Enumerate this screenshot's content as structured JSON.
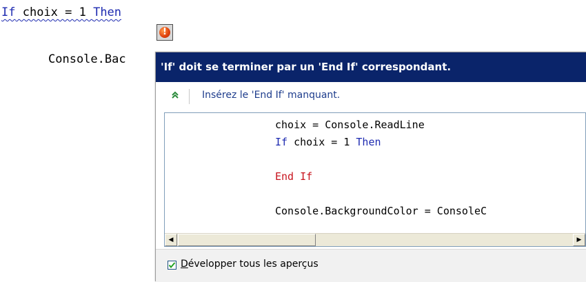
{
  "editor": {
    "line1": {
      "kw_if": "If",
      "mid": " choix = 1 ",
      "kw_then": "Then"
    },
    "line2": "Console.Bac"
  },
  "smart_tag": {
    "icon": "error-icon",
    "glyph": "!"
  },
  "popup": {
    "title": "'If' doit se terminer par un 'End If' correspondant.",
    "fix": {
      "icon": "double-chevron-up-icon",
      "glyph": "≫",
      "label": "Insérez le 'End If' manquant."
    },
    "preview_lines": [
      {
        "text": "choix = Console.ReadLine",
        "style": "plain"
      },
      {
        "kw_if": "If",
        "mid": " choix = 1 ",
        "kw_then": "Then",
        "style": "if"
      },
      {
        "text": "",
        "style": "blank"
      },
      {
        "text": "End If",
        "style": "inserted"
      },
      {
        "text": "",
        "style": "blank"
      },
      {
        "text": "Console.BackgroundColor = ConsoleC",
        "style": "plain"
      }
    ],
    "scrollbar": {
      "left_glyph": "◀",
      "right_glyph": "▶"
    },
    "footer": {
      "checkbox_checked": true,
      "label_first": "D",
      "label_rest": "évelopper tous les aperçus"
    }
  },
  "colors": {
    "keyword": "#1d2ab0",
    "inserted": "#c8141e",
    "header_bg": "#0a246a",
    "link": "#1d3c8c"
  }
}
